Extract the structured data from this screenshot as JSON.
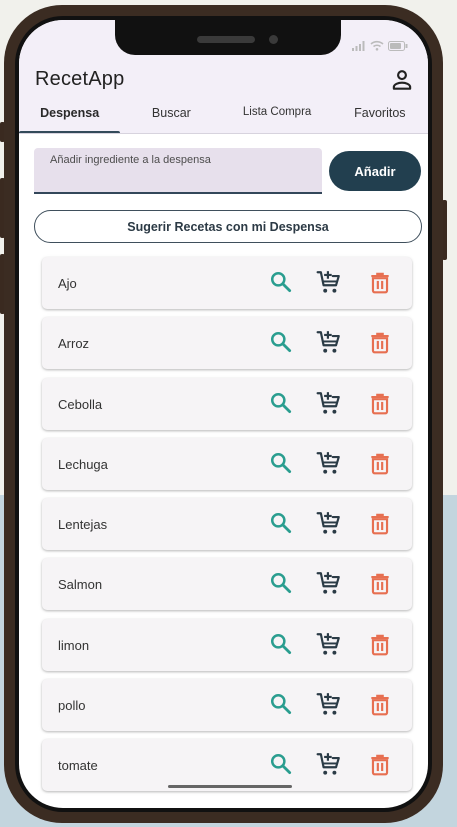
{
  "app": {
    "title": "RecetApp"
  },
  "tabs": [
    {
      "label": "Despensa",
      "active": true
    },
    {
      "label": "Buscar",
      "active": false
    },
    {
      "label": "Lista Compra",
      "active": false
    },
    {
      "label": "Favoritos",
      "active": false
    }
  ],
  "pantry": {
    "input_placeholder": "Añadir ingrediente a la despensa",
    "add_label": "Añadir",
    "suggest_label": "Sugerir Recetas con mi Despensa",
    "items": [
      {
        "name": "Ajo"
      },
      {
        "name": "Arroz"
      },
      {
        "name": "Cebolla"
      },
      {
        "name": "Lechuga"
      },
      {
        "name": "Lentejas"
      },
      {
        "name": "Salmon"
      },
      {
        "name": "limon"
      },
      {
        "name": "pollo"
      },
      {
        "name": "tomate"
      }
    ]
  },
  "icons": {
    "profile": "person-icon",
    "search": "search-icon",
    "cart": "add-to-cart-icon",
    "delete": "trash-icon"
  },
  "colors": {
    "primary": "#223f4f",
    "search": "#2a9d8f",
    "cart": "#2b3b46",
    "delete": "#e76f51",
    "app_bar": "#f3eff8"
  }
}
